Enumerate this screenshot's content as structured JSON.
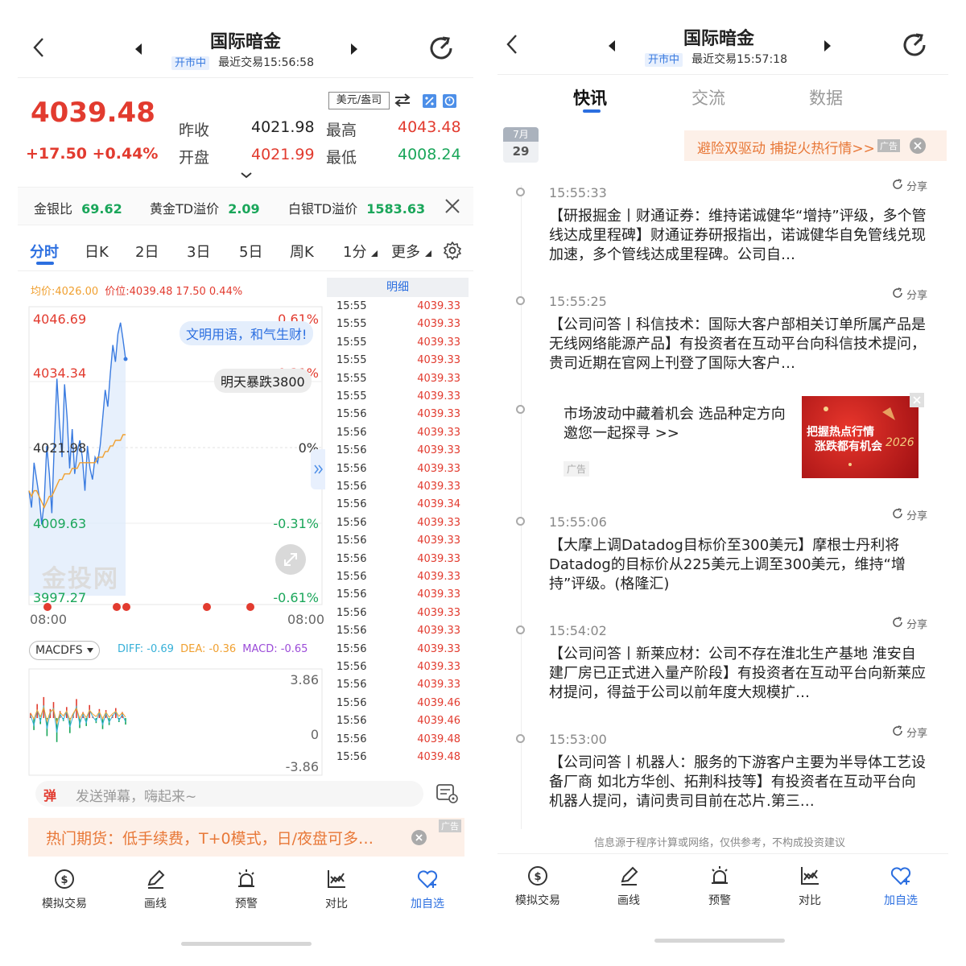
{
  "left": {
    "nav": {
      "title": "国际暗金",
      "status": "开市中",
      "last_trade": "最近交易15:56:58"
    },
    "quote": {
      "price": "4039.48",
      "change": "+17.50 +0.44%",
      "currency_select": "美元/盎司",
      "prev_close_label": "昨收",
      "prev_close": "4021.98",
      "high_label": "最高",
      "high": "4043.48",
      "open_label": "开盘",
      "open": "4021.99",
      "low_label": "最低",
      "low": "4008.24"
    },
    "ratios": {
      "gs_label": "金银比",
      "gs_value": "69.62",
      "gold_td_label": "黄金TD溢价",
      "gold_td_value": "2.09",
      "silver_td_label": "白银TD溢价",
      "silver_td_value": "1583.63"
    },
    "tabs": [
      "分时",
      "日K",
      "2日",
      "3日",
      "5日",
      "周K",
      "1分",
      "更多"
    ],
    "avg_line": {
      "avg": "均价:4026.00",
      "price": "价位:4039.48 17.50 0.44%"
    },
    "bubbles": {
      "b1": "文明用语，和气生财!",
      "b2": "明天暴跌3800"
    },
    "watermark": "金投网",
    "macd": {
      "selector": "MACDFS",
      "diff": "DIFF: -0.69",
      "dea": "DEA: -0.36",
      "macd": "MACD: -0.65"
    },
    "details_title": "明细",
    "details": [
      {
        "t": "15:55",
        "v": "4039.33"
      },
      {
        "t": "15:55",
        "v": "4039.33"
      },
      {
        "t": "15:55",
        "v": "4039.33"
      },
      {
        "t": "15:55",
        "v": "4039.33"
      },
      {
        "t": "15:55",
        "v": "4039.33"
      },
      {
        "t": "15:55",
        "v": "4039.33"
      },
      {
        "t": "15:56",
        "v": "4039.33"
      },
      {
        "t": "15:56",
        "v": "4039.33"
      },
      {
        "t": "15:56",
        "v": "4039.33"
      },
      {
        "t": "15:56",
        "v": "4039.33"
      },
      {
        "t": "15:56",
        "v": "4039.33"
      },
      {
        "t": "15:56",
        "v": "4039.34"
      },
      {
        "t": "15:56",
        "v": "4039.33"
      },
      {
        "t": "15:56",
        "v": "4039.33"
      },
      {
        "t": "15:56",
        "v": "4039.33"
      },
      {
        "t": "15:56",
        "v": "4039.33"
      },
      {
        "t": "15:56",
        "v": "4039.33"
      },
      {
        "t": "15:56",
        "v": "4039.33"
      },
      {
        "t": "15:56",
        "v": "4039.33"
      },
      {
        "t": "15:56",
        "v": "4039.33"
      },
      {
        "t": "15:56",
        "v": "4039.33"
      },
      {
        "t": "15:56",
        "v": "4039.33"
      },
      {
        "t": "15:56",
        "v": "4039.46"
      },
      {
        "t": "15:56",
        "v": "4039.46"
      },
      {
        "t": "15:56",
        "v": "4039.48"
      },
      {
        "t": "15:56",
        "v": "4039.48"
      }
    ],
    "danmaku": {
      "badge": "弹",
      "placeholder": "发送弹幕，嗨起来~"
    },
    "ad": {
      "text": "热门期货：低手续费，T+0模式，日/夜盘可多…",
      "tag": "广告"
    },
    "toolbar": [
      "模拟交易",
      "画线",
      "预警",
      "对比",
      "加自选"
    ]
  },
  "right": {
    "nav": {
      "title": "国际暗金",
      "status": "开市中",
      "last_trade": "最近交易15:57:18"
    },
    "tabs": [
      "快讯",
      "交流",
      "数据"
    ],
    "date": {
      "month": "7月",
      "day": "29"
    },
    "promo": {
      "text": "避险双驱动 捕捉火热行情>>",
      "tag": "广告"
    },
    "share_label": "分享",
    "news": [
      {
        "time": "15:55:33",
        "text": "【研报掘金丨财通证券：维持诺诚健华“增持”评级，多个管线达成里程碑】财通证券研报指出，诺诚健华自免管线兑现加速，多个管线达成里程碑。公司自…"
      },
      {
        "time": "15:55:25",
        "text": "【公司问答丨科信技术：国际大客户部相关订单所属产品是无线网络能源产品】有投资者在互动平台向科信技术提问，贵司近期在官网上刊登了国际大客户…"
      },
      {
        "time": "15:55:06",
        "text": "【大摩上调Datadog目标价至300美元】摩根士丹利将Datadog的目标价从225美元上调至300美元，维持“增持”评级。(格隆汇)"
      },
      {
        "time": "15:54:02",
        "text": "【公司问答丨新莱应材：公司不存在淮北生产基地 淮安自建厂房已正式进入量产阶段】有投资者在互动平台向新莱应材提问，得益于公司以前年度大规模扩…"
      },
      {
        "time": "15:53:00",
        "text": "【公司问答丨机器人：服务的下游客户主要为半导体工艺设备厂商 如北方华创、拓荆科技等】有投资者在互动平台向机器人提问，请问贵司目前在芯片.第三…"
      }
    ],
    "ad_item": {
      "text": "市场波动中藏着机会 选品种定方向 邀您一起探寻 >>",
      "tag": "广告",
      "img_line1": "把握热点行情",
      "img_line2": "涨跌都有机会",
      "img_year": "2026"
    },
    "disclaimer": "信息源于程序计算或网络，仅供参考，不构成投资建议",
    "toolbar": [
      "模拟交易",
      "画线",
      "预警",
      "对比",
      "加自选"
    ]
  },
  "chart_data": [
    {
      "type": "line",
      "title": "分时",
      "y_labels_left": [
        "4046.69",
        "4034.34",
        "4021.98",
        "4009.63",
        "3997.27"
      ],
      "y_labels_right": [
        "0.61%",
        "0.31%",
        "0%",
        "-0.31%",
        "-0.61%"
      ],
      "x_labels": [
        "08:00",
        "08:00"
      ],
      "ylim": [
        3997.27,
        4046.69
      ],
      "series": [
        {
          "name": "价位",
          "values": [
            4016,
            4013,
            4021,
            4018,
            4015,
            4010,
            4014,
            4024,
            4019,
            4012,
            4025,
            4036,
            4028,
            4022,
            4035,
            4029,
            4020,
            4027,
            4019,
            4023,
            4025,
            4022,
            4016,
            4024,
            4020,
            4018,
            4022,
            4021,
            4024,
            4029,
            4034,
            4031,
            4037,
            4042,
            4039,
            4044,
            4046,
            4043,
            4039.5
          ]
        },
        {
          "name": "均价",
          "values": [
            4016,
            4015,
            4016,
            4016,
            4015,
            4014,
            4013,
            4014,
            4015,
            4015,
            4016,
            4017,
            4018,
            4018,
            4019,
            4019,
            4019,
            4020,
            4020,
            4020,
            4021,
            4021,
            4021,
            4021,
            4021,
            4021,
            4021,
            4022,
            4022,
            4022,
            4023,
            4023,
            4024,
            4024,
            4025,
            4025,
            4025,
            4026,
            4026
          ]
        }
      ],
      "grid": true
    },
    {
      "type": "bar",
      "title": "MACDFS",
      "y_labels": [
        "3.86",
        "0",
        "-3.86"
      ],
      "ylim": [
        -3.86,
        3.86
      ],
      "series": [
        {
          "name": "MACD",
          "values": [
            0.5,
            -1.2,
            1.4,
            -0.6,
            2.1,
            -1.8,
            0.9,
            1.6,
            -2.4,
            0.7,
            -0.3,
            1.1,
            -1.5,
            0.4,
            1.9,
            -1.0,
            0.6,
            -0.8,
            1.3,
            0.2,
            -0.5,
            0.9,
            -1.1,
            0.8,
            -0.7,
            0.3,
            1.0,
            -0.4,
            0.6,
            -0.65
          ]
        }
      ]
    }
  ]
}
